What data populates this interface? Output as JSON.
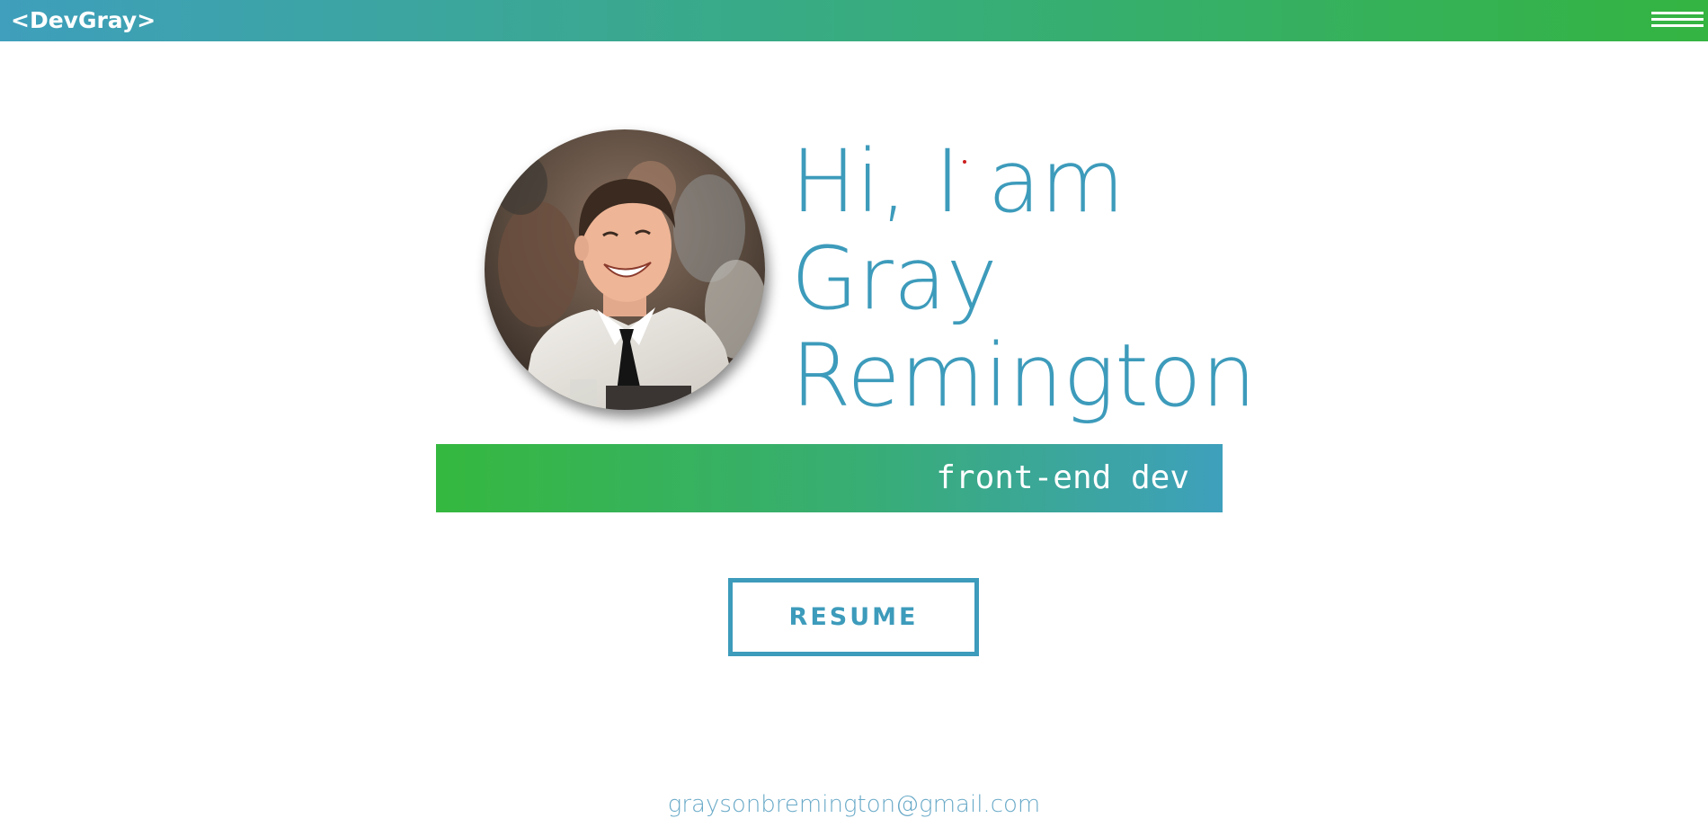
{
  "header": {
    "logo_text": "<DevGray>",
    "menu_icon": "hamburger-menu-icon"
  },
  "hero": {
    "greeting_line1": "Hi, I am",
    "name_first": "Gray",
    "name_last": "Remington",
    "role": "front-end dev",
    "photo_alt": "Portrait of Gray Remington"
  },
  "actions": {
    "resume_label": "RESUME"
  },
  "footer": {
    "email": "graysonbremington@gmail.com"
  },
  "colors": {
    "primary_blue": "#3d9bbb",
    "gradient_green": "#34b441",
    "gradient_blue": "#3f9fbc",
    "email_blue": "#6aaac8",
    "background": "#ffffff"
  }
}
